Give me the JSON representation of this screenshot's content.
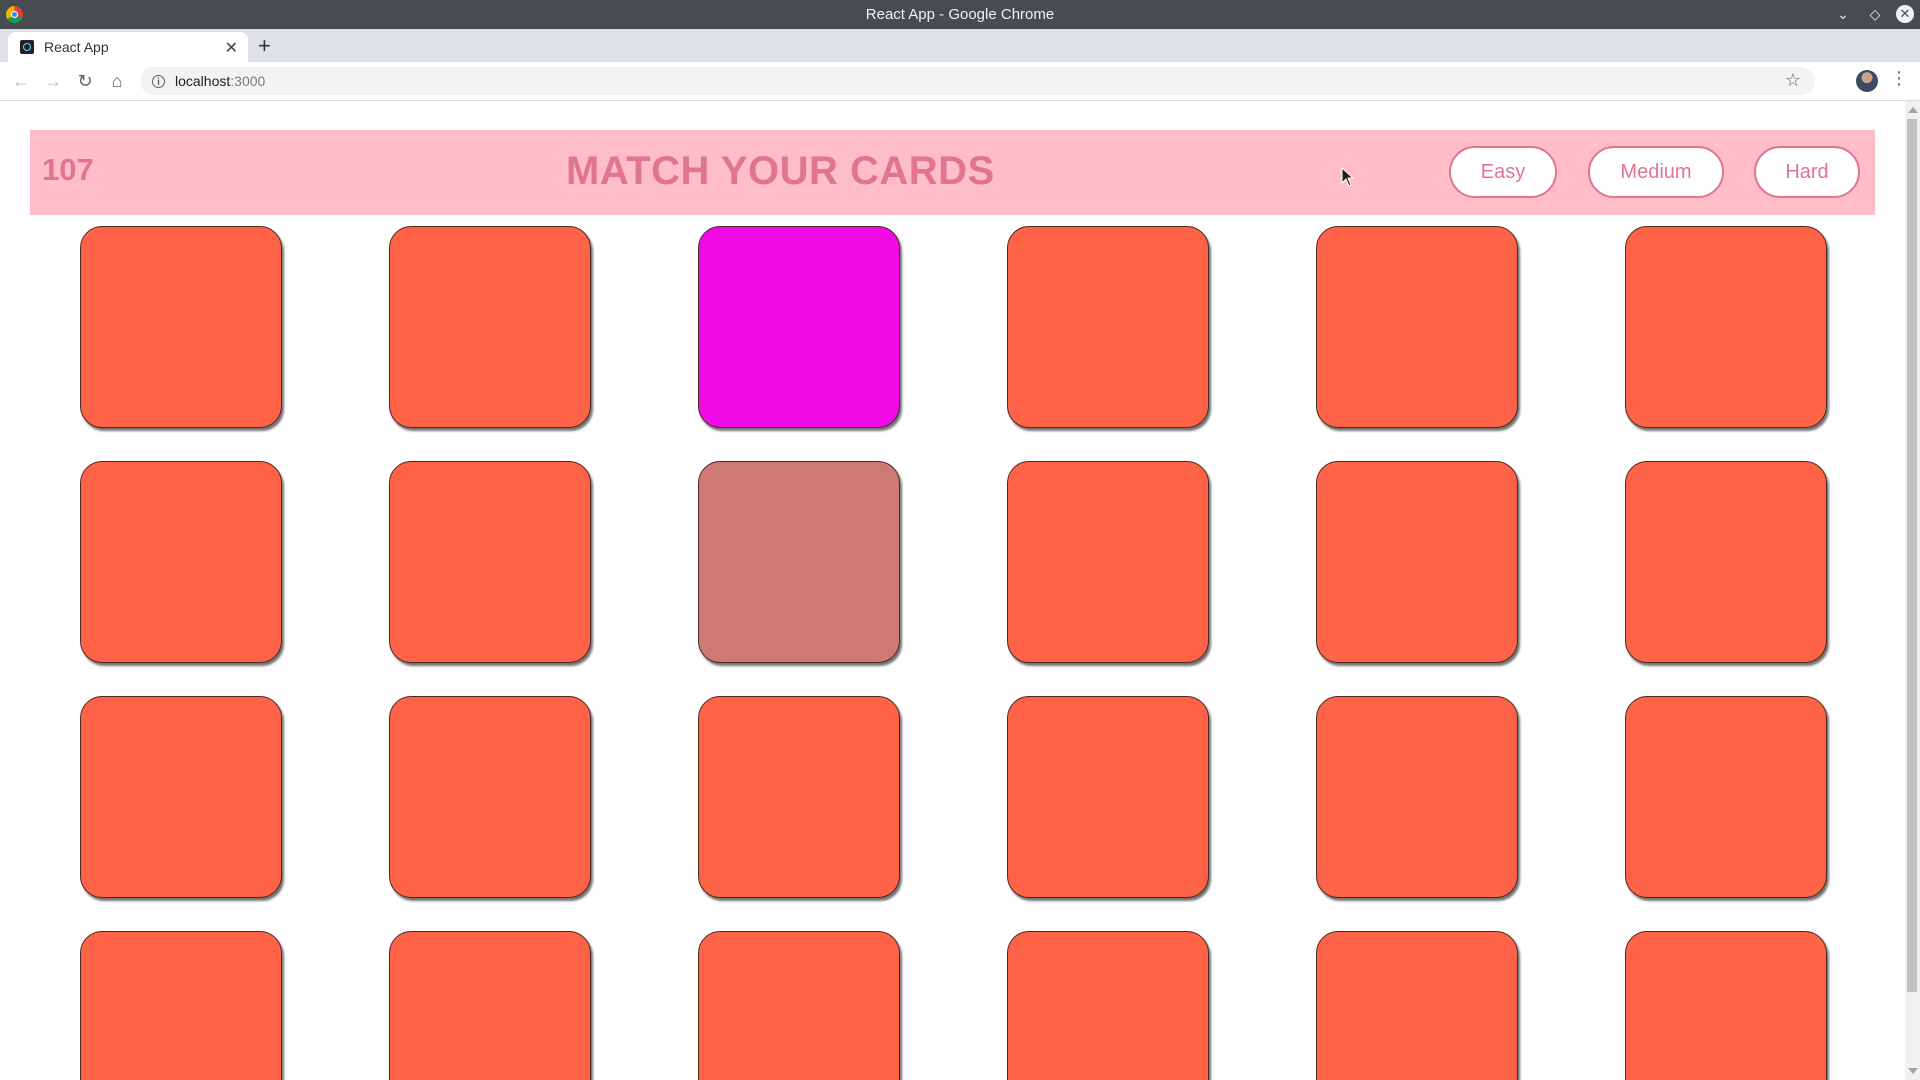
{
  "window": {
    "title": "React App - Google Chrome"
  },
  "tab": {
    "label": "React App"
  },
  "address_bar": {
    "host": "localhost",
    "port": ":3000"
  },
  "game": {
    "score": "107",
    "title": "MATCH YOUR CARDS",
    "levels": [
      "Easy",
      "Medium",
      "Hard"
    ]
  },
  "colors": {
    "header_bg": "#ffbcc9",
    "accent": "#e0758f",
    "card_back": "#ff6347",
    "card_revealed": "#f00ae6",
    "card_matched": "#cd7a75"
  },
  "cards": [
    [
      "back",
      "back",
      "revealed",
      "back",
      "back",
      "back"
    ],
    [
      "back",
      "back",
      "matched",
      "back",
      "back",
      "back"
    ],
    [
      "back",
      "back",
      "back",
      "back",
      "back",
      "back"
    ],
    [
      "back",
      "back",
      "back",
      "back",
      "back",
      "back"
    ]
  ]
}
